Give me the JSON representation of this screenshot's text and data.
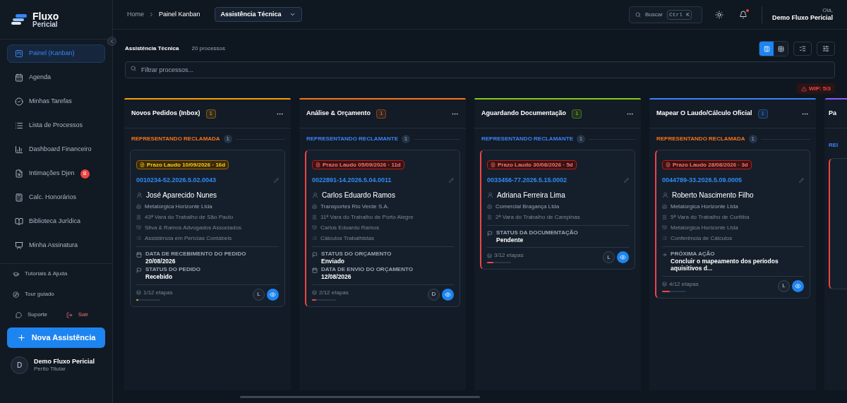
{
  "brand": {
    "name": "Fluxo",
    "sub": "Pericial"
  },
  "sidebar": {
    "items": [
      {
        "label": "Painel (Kanban)",
        "selected": true
      },
      {
        "label": "Agenda",
        "selected": false
      },
      {
        "label": "Minhas Tarefas",
        "selected": false
      },
      {
        "label": "Lista de Processos",
        "selected": false
      },
      {
        "label": "Dashboard Financeiro",
        "selected": false
      },
      {
        "label": "Intimações Djen",
        "selected": false,
        "badge": "8"
      },
      {
        "label": "Calc. Honorários",
        "selected": false
      },
      {
        "label": "Biblioteca Jurídica",
        "selected": false
      },
      {
        "label": "Minha Assinatura",
        "selected": false
      }
    ],
    "links": [
      "Tutoriais & Ajuda",
      "Tour guiado"
    ],
    "support": "Suporte",
    "logout": "Sair",
    "new_button": "Nova Assistência",
    "user": {
      "initial": "D",
      "name": "Demo Fluxo Pericial",
      "role": "Perito Titular"
    }
  },
  "header": {
    "breadcrumb": [
      "Home",
      "Painel Kanban"
    ],
    "select": "Assistência Técnica",
    "search": "Buscar",
    "shortcut": "Ctrl K",
    "notification_dot": true,
    "greeting": "Olá,",
    "user": "Demo Fluxo Pericial"
  },
  "toolbar": {
    "title": "Assistência Técnica",
    "count": "20 processos",
    "views": [
      {
        "selected": true
      },
      {
        "selected": false
      }
    ],
    "filter_placeholder": "Filtrar processos...",
    "wip": "WIP: 5/3"
  },
  "columns": [
    {
      "title": "Novos Pedidos (Inbox)",
      "count": "1",
      "color": "#f59e0b",
      "group": {
        "label": "REPRESENTANDO RECLAMADA",
        "count": "1",
        "color": "#f97316"
      },
      "card": {
        "urgent": false,
        "deadline": {
          "text": "Prazo Laudo 10/09/2026 · 16d"
        },
        "number": "0010234-52.2026.5.02.0043",
        "client": "José Aparecido Nunes",
        "company": "Metalúrgica Horizonte Ltda",
        "court": "43ª Vara do Trabalho de São Paulo",
        "lawyer": "Silva & Ramos Advogados Associados",
        "service": "Assistência em Perícias Contábeis",
        "fields": [
          {
            "kind": "date",
            "label": "DATA DE RECEBIMENTO DO PEDIDO",
            "value": "20/08/2026"
          },
          {
            "kind": "status",
            "label": "STATUS DO PEDIDO",
            "value": "Recebido"
          }
        ],
        "progress": "1/12 etapas",
        "level": 0.083,
        "avatar": "L"
      }
    },
    {
      "title": "Análise & Orçamento",
      "count": "1",
      "color": "#f97316",
      "group": {
        "label": "REPRESENTANDO RECLAMANTE",
        "count": "1",
        "color": "#3b82f6"
      },
      "card": {
        "urgent": true,
        "deadline": {
          "text": "Prazo Laudo 05/09/2026 · 11d"
        },
        "number": "0022891-14.2026.5.04.0011",
        "client": "Carlos Eduardo Ramos",
        "company": "Transportes Rio Verde S.A.",
        "court": "11ª Vara do Trabalho de Porto Alegre",
        "lawyer": "Carlos Eduardo Ramos",
        "service": "Cálculos Trabalhistas",
        "fields": [
          {
            "kind": "status",
            "label": "STATUS DO ORÇAMENTO",
            "value": "Enviado"
          },
          {
            "kind": "date",
            "label": "DATA DE ENVIO DO ORÇAMENTO",
            "value": "12/08/2026"
          }
        ],
        "progress": "2/12 etapas",
        "level": 0.167,
        "avatar": "D"
      }
    },
    {
      "title": "Aguardando Documentação",
      "count": "1",
      "color": "#84cc16",
      "group": {
        "label": "REPRESENTANDO RECLAMANTE",
        "count": "1",
        "color": "#3b82f6"
      },
      "card": {
        "urgent": true,
        "deadline": {
          "text": "Prazo Laudo 30/08/2026 · 5d"
        },
        "number": "0033456-77.2026.5.15.0002",
        "client": "Adriana Ferreira Lima",
        "company": "Comercial Bragança Ltda",
        "court": "2ª Vara do Trabalho de Campinas",
        "fields": [
          {
            "kind": "status",
            "label": "STATUS DA DOCUMENTAÇÃO",
            "value": "Pendente"
          }
        ],
        "progress": "3/12 etapas",
        "level": 0.25,
        "avatar": "L"
      }
    },
    {
      "title": "Mapear O Laudo/Cálculo Oficial",
      "count": "1",
      "color": "#3b82f6",
      "group": {
        "label": "REPRESENTANDO RECLAMADA",
        "count": "1",
        "color": "#f97316"
      },
      "card": {
        "urgent": true,
        "deadline": {
          "text": "Prazo Laudo 28/08/2026 · 3d"
        },
        "number": "0044789-33.2026.5.09.0005",
        "client": "Roberto Nascimento Filho",
        "company": "Metalúrgica Horizonte Ltda",
        "court": "5ª Vara do Trabalho de Curitiba",
        "lawyer": "Metalúrgica Horizonte Ltda",
        "service": "Conferência de Cálculos",
        "fields": [
          {
            "kind": "action",
            "label": "PRÓXIMA AÇÃO",
            "value": "Concluir o mapeamento dos períodos aquisitivos d..."
          }
        ],
        "progress": "4/12 etapas",
        "level": 0.333,
        "avatar": "L"
      }
    }
  ],
  "partial_column": {
    "title": "Pa",
    "group": "REI",
    "color": "#8b5cf6"
  }
}
